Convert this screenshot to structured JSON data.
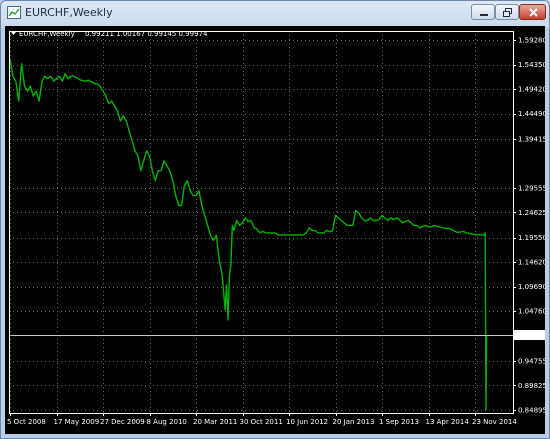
{
  "window": {
    "title": "EURCHF,Weekly"
  },
  "chart_data": {
    "type": "line",
    "title": "EURCHF,Weekly",
    "ohlc": "0.99211 1.00167 0.99145 0.99974",
    "x_labels": [
      "5 Oct 2008",
      "17 May 2009",
      "27 Dec 2009",
      "8 Aug 2010",
      "20 Mar 2011",
      "30 Oct 2011",
      "10 Jun 2012",
      "20 Jan 2013",
      "1 Sep 2013",
      "13 Apr 2014",
      "23 Nov 2014"
    ],
    "y_ticks": [
      "1.59280",
      "1.54350",
      "1.49420",
      "1.44490",
      "1.39415",
      "1.29555",
      "1.24625",
      "1.19550",
      "1.14620",
      "1.09690",
      "1.04760",
      "0.99974",
      "0.94755",
      "0.89825",
      "0.84895"
    ],
    "ylim": [
      0.84895,
      1.5928
    ],
    "current_price": 0.99974,
    "series": [
      {
        "color": "#00b400",
        "points": [
          [
            "5 Oct 2008",
            1.555
          ],
          [
            "19 Oct 2008",
            1.52
          ],
          [
            "2 Nov 2008",
            1.51
          ],
          [
            "16 Nov 2008",
            1.47
          ],
          [
            "30 Nov 2008",
            1.545
          ],
          [
            "14 Dec 2008",
            1.5
          ],
          [
            "28 Dec 2008",
            1.49
          ],
          [
            "11 Jan 2009",
            1.5
          ],
          [
            "25 Jan 2009",
            1.48
          ],
          [
            "8 Feb 2009",
            1.49
          ],
          [
            "22 Feb 2009",
            1.47
          ],
          [
            "8 Mar 2009",
            1.51
          ],
          [
            "22 Mar 2009",
            1.52
          ],
          [
            "5 Apr 2009",
            1.515
          ],
          [
            "19 Apr 2009",
            1.52
          ],
          [
            "3 May 2009",
            1.51
          ],
          [
            "17 May 2009",
            1.515
          ],
          [
            "31 May 2009",
            1.52
          ],
          [
            "14 Jun 2009",
            1.51
          ],
          [
            "28 Jun 2009",
            1.525
          ],
          [
            "12 Jul 2009",
            1.515
          ],
          [
            "26 Jul 2009",
            1.52
          ],
          [
            "9 Aug 2009",
            1.52
          ],
          [
            "23 Aug 2009",
            1.517
          ],
          [
            "6 Sep 2009",
            1.513
          ],
          [
            "20 Sep 2009",
            1.511
          ],
          [
            "4 Oct 2009",
            1.51
          ],
          [
            "18 Oct 2009",
            1.512
          ],
          [
            "1 Nov 2009",
            1.509
          ],
          [
            "15 Nov 2009",
            1.505
          ],
          [
            "29 Nov 2009",
            1.505
          ],
          [
            "13 Dec 2009",
            1.5
          ],
          [
            "27 Dec 2009",
            1.49
          ],
          [
            "10 Jan 2010",
            1.48
          ],
          [
            "24 Jan 2010",
            1.465
          ],
          [
            "7 Feb 2010",
            1.47
          ],
          [
            "21 Feb 2010",
            1.46
          ],
          [
            "7 Mar 2010",
            1.45
          ],
          [
            "21 Mar 2010",
            1.43
          ],
          [
            "4 Apr 2010",
            1.44
          ],
          [
            "18 Apr 2010",
            1.43
          ],
          [
            "2 May 2010",
            1.41
          ],
          [
            "16 May 2010",
            1.39
          ],
          [
            "30 May 2010",
            1.37
          ],
          [
            "13 Jun 2010",
            1.36
          ],
          [
            "27 Jun 2010",
            1.33
          ],
          [
            "11 Jul 2010",
            1.35
          ],
          [
            "25 Jul 2010",
            1.37
          ],
          [
            "8 Aug 2010",
            1.36
          ],
          [
            "22 Aug 2010",
            1.33
          ],
          [
            "5 Sep 2010",
            1.31
          ],
          [
            "19 Sep 2010",
            1.33
          ],
          [
            "3 Oct 2010",
            1.33
          ],
          [
            "17 Oct 2010",
            1.35
          ],
          [
            "31 Oct 2010",
            1.34
          ],
          [
            "14 Nov 2010",
            1.33
          ],
          [
            "28 Nov 2010",
            1.31
          ],
          [
            "12 Dec 2010",
            1.28
          ],
          [
            "26 Dec 2010",
            1.26
          ],
          [
            "9 Jan 2011",
            1.26
          ],
          [
            "23 Jan 2011",
            1.3
          ],
          [
            "6 Feb 2011",
            1.31
          ],
          [
            "20 Feb 2011",
            1.29
          ],
          [
            "6 Mar 2011",
            1.28
          ],
          [
            "20 Mar 2011",
            1.28
          ],
          [
            "3 Apr 2011",
            1.29
          ],
          [
            "17 Apr 2011",
            1.26
          ],
          [
            "1 May 2011",
            1.24
          ],
          [
            "15 May 2011",
            1.22
          ],
          [
            "29 May 2011",
            1.2
          ],
          [
            "12 Jun 2011",
            1.19
          ],
          [
            "26 Jun 2011",
            1.2
          ],
          [
            "10 Jul 2011",
            1.15
          ],
          [
            "24 Jul 2011",
            1.12
          ],
          [
            "7 Aug 2011",
            1.05
          ],
          [
            "14 Aug 2011",
            1.1
          ],
          [
            "21 Aug 2011",
            1.03
          ],
          [
            "28 Aug 2011",
            1.12
          ],
          [
            "4 Sep 2011",
            1.14
          ],
          [
            "11 Sep 2011",
            1.22
          ],
          [
            "18 Sep 2011",
            1.21
          ],
          [
            "2 Oct 2011",
            1.23
          ],
          [
            "16 Oct 2011",
            1.22
          ],
          [
            "30 Oct 2011",
            1.225
          ],
          [
            "13 Nov 2011",
            1.235
          ],
          [
            "27 Nov 2011",
            1.228
          ],
          [
            "11 Dec 2011",
            1.23
          ],
          [
            "25 Dec 2011",
            1.215
          ],
          [
            "8 Jan 2012",
            1.213
          ],
          [
            "22 Jan 2012",
            1.205
          ],
          [
            "5 Feb 2012",
            1.208
          ],
          [
            "19 Feb 2012",
            1.205
          ],
          [
            "4 Mar 2012",
            1.205
          ],
          [
            "18 Mar 2012",
            1.205
          ],
          [
            "1 Apr 2012",
            1.205
          ],
          [
            "15 Apr 2012",
            1.202
          ],
          [
            "29 Apr 2012",
            1.201
          ],
          [
            "13 May 2012",
            1.201
          ],
          [
            "27 May 2012",
            1.201
          ],
          [
            "10 Jun 2012",
            1.201
          ],
          [
            "24 Jun 2012",
            1.201
          ],
          [
            "8 Jul 2012",
            1.201
          ],
          [
            "22 Jul 2012",
            1.201
          ],
          [
            "5 Aug 2012",
            1.201
          ],
          [
            "19 Aug 2012",
            1.201
          ],
          [
            "2 Sep 2012",
            1.205
          ],
          [
            "16 Sep 2012",
            1.215
          ],
          [
            "30 Sep 2012",
            1.21
          ],
          [
            "14 Oct 2012",
            1.21
          ],
          [
            "28 Oct 2012",
            1.205
          ],
          [
            "11 Nov 2012",
            1.205
          ],
          [
            "25 Nov 2012",
            1.205
          ],
          [
            "9 Dec 2012",
            1.21
          ],
          [
            "23 Dec 2012",
            1.207
          ],
          [
            "6 Jan 2013",
            1.21
          ],
          [
            "20 Jan 2013",
            1.24
          ],
          [
            "3 Feb 2013",
            1.235
          ],
          [
            "17 Feb 2013",
            1.23
          ],
          [
            "3 Mar 2013",
            1.225
          ],
          [
            "17 Mar 2013",
            1.22
          ],
          [
            "31 Mar 2013",
            1.22
          ],
          [
            "14 Apr 2013",
            1.22
          ],
          [
            "28 Apr 2013",
            1.25
          ],
          [
            "12 May 2013",
            1.245
          ],
          [
            "26 May 2013",
            1.235
          ],
          [
            "9 Jun 2013",
            1.23
          ],
          [
            "23 Jun 2013",
            1.23
          ],
          [
            "7 Jul 2013",
            1.235
          ],
          [
            "21 Jul 2013",
            1.23
          ],
          [
            "4 Aug 2013",
            1.23
          ],
          [
            "18 Aug 2013",
            1.232
          ],
          [
            "1 Sep 2013",
            1.24
          ],
          [
            "15 Sep 2013",
            1.235
          ],
          [
            "29 Sep 2013",
            1.23
          ],
          [
            "13 Oct 2013",
            1.235
          ],
          [
            "27 Oct 2013",
            1.232
          ],
          [
            "10 Nov 2013",
            1.235
          ],
          [
            "24 Nov 2013",
            1.232
          ],
          [
            "8 Dec 2013",
            1.225
          ],
          [
            "22 Dec 2013",
            1.228
          ],
          [
            "5 Jan 2014",
            1.23
          ],
          [
            "19 Jan 2014",
            1.225
          ],
          [
            "2 Feb 2014",
            1.22
          ],
          [
            "16 Feb 2014",
            1.22
          ],
          [
            "2 Mar 2014",
            1.215
          ],
          [
            "16 Mar 2014",
            1.218
          ],
          [
            "30 Mar 2014",
            1.22
          ],
          [
            "13 Apr 2014",
            1.217
          ],
          [
            "27 Apr 2014",
            1.217
          ],
          [
            "11 May 2014",
            1.22
          ],
          [
            "25 May 2014",
            1.218
          ],
          [
            "8 Jun 2014",
            1.217
          ],
          [
            "22 Jun 2014",
            1.215
          ],
          [
            "6 Jul 2014",
            1.214
          ],
          [
            "20 Jul 2014",
            1.214
          ],
          [
            "3 Aug 2014",
            1.212
          ],
          [
            "17 Aug 2014",
            1.208
          ],
          [
            "31 Aug 2014",
            1.206
          ],
          [
            "14 Sep 2014",
            1.207
          ],
          [
            "28 Sep 2014",
            1.208
          ],
          [
            "12 Oct 2014",
            1.205
          ],
          [
            "26 Oct 2014",
            1.204
          ],
          [
            "9 Nov 2014",
            1.203
          ],
          [
            "23 Nov 2014",
            1.202
          ],
          [
            "7 Dec 2014",
            1.201
          ],
          [
            "21 Dec 2014",
            1.201
          ],
          [
            "4 Jan 2015",
            1.201
          ],
          [
            "11 Jan 2015",
            1.205
          ],
          [
            "15 Jan 2015",
            0.85
          ],
          [
            "18 Jan 2015",
            0.99974
          ]
        ]
      }
    ]
  }
}
